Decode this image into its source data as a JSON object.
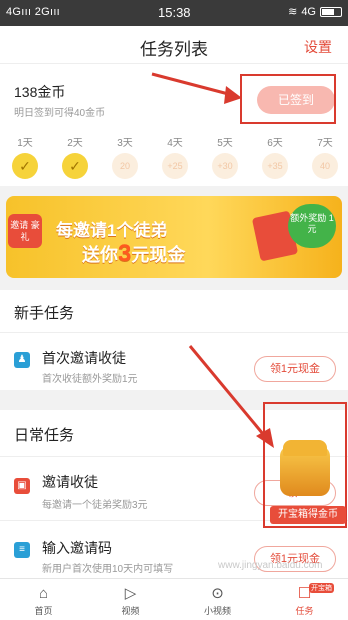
{
  "status_bar": {
    "left": "4Gııı 2Gııı",
    "time": "15:38",
    "right": "4G"
  },
  "header": {
    "title": "任务列表",
    "settings": "设置"
  },
  "signin": {
    "coins": "138金币",
    "tip": "明日签到可得40金币",
    "button": "已签到",
    "days": [
      {
        "label": "1天",
        "reward": "✓",
        "done": true
      },
      {
        "label": "2天",
        "reward": "✓",
        "done": true
      },
      {
        "label": "3天",
        "reward": "20",
        "done": false
      },
      {
        "label": "4天",
        "reward": "+25",
        "done": false
      },
      {
        "label": "5天",
        "reward": "+30",
        "done": false
      },
      {
        "label": "6天",
        "reward": "+35",
        "done": false
      },
      {
        "label": "7天",
        "reward": "40",
        "done": false
      }
    ]
  },
  "banner": {
    "tag": "邀请 豪礼",
    "line1": "每邀请1个徒弟",
    "line2_prefix": "送你",
    "line2_big": "3",
    "line2_suffix": "元现金",
    "badge": "额外奖励 1元"
  },
  "novice": {
    "title": "新手任务",
    "tasks": [
      {
        "name": "首次邀请收徒",
        "desc": "首次收徒额外奖励1元",
        "button": "领1元现金",
        "icon": "person-icon",
        "color": "#2a9fd6"
      }
    ]
  },
  "daily": {
    "title": "日常任务",
    "tasks": [
      {
        "name": "邀请收徒",
        "desc": "每邀请一个徒弟奖励3元",
        "button": "领3",
        "icon": "gift-icon",
        "color": "#e84d3a"
      },
      {
        "name": "输入邀请码",
        "desc": "新用户首次使用10天内可填写",
        "button": "领1元现金",
        "icon": "code-icon",
        "color": "#2a9fd6"
      }
    ]
  },
  "treasure": {
    "label": "开宝箱得金币"
  },
  "tabs": [
    {
      "label": "首页",
      "icon": "home-icon",
      "glyph": "⌂"
    },
    {
      "label": "视频",
      "icon": "play-icon",
      "glyph": "▷"
    },
    {
      "label": "小视频",
      "icon": "short-video-icon",
      "glyph": "⊙"
    },
    {
      "label": "任务",
      "icon": "task-icon",
      "glyph": "☐",
      "badge": "开宝箱",
      "active": true
    }
  ],
  "watermark": "www.jingyan.baidu.com"
}
